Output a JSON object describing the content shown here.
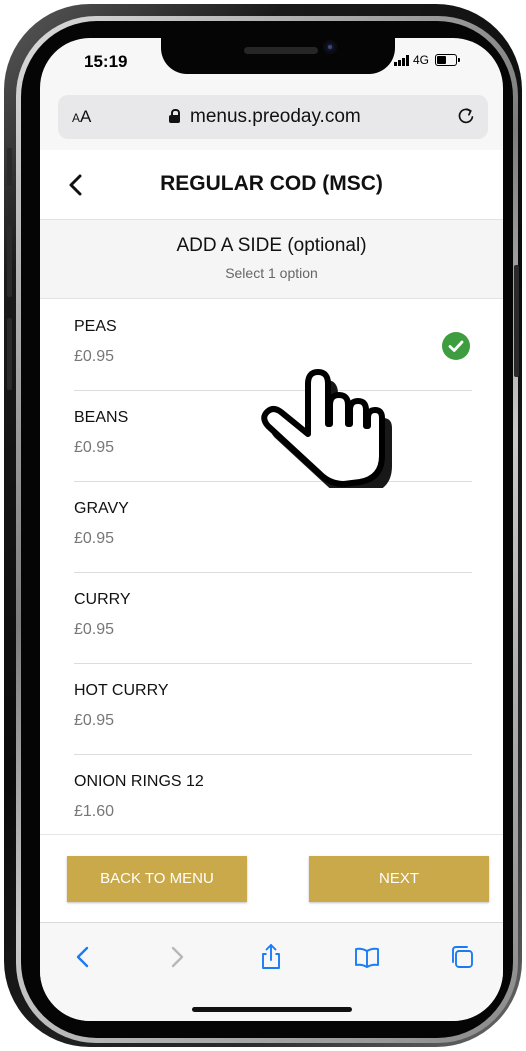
{
  "status": {
    "time": "15:19",
    "network": "4G"
  },
  "browser": {
    "text_size_label": "AA",
    "url": "menus.preoday.com"
  },
  "header": {
    "title": "REGULAR COD (MSC)"
  },
  "section": {
    "title": "ADD A SIDE (optional)",
    "subtitle": "Select 1 option"
  },
  "options": [
    {
      "name": "PEAS",
      "price": "£0.95",
      "selected": true
    },
    {
      "name": "BEANS",
      "price": "£0.95",
      "selected": false
    },
    {
      "name": "GRAVY",
      "price": "£0.95",
      "selected": false
    },
    {
      "name": "CURRY",
      "price": "£0.95",
      "selected": false
    },
    {
      "name": "HOT CURRY",
      "price": "£0.95",
      "selected": false
    },
    {
      "name": "ONION RINGS 12",
      "price": "£1.60",
      "selected": false
    }
  ],
  "actions": {
    "back_label": "BACK TO MENU",
    "next_label": "NEXT"
  },
  "colors": {
    "accent": "#c9a94a",
    "check": "#3e9d3f",
    "ios_blue": "#1a7cf5"
  },
  "icons": {
    "toolbar": [
      "back-icon",
      "forward-icon",
      "share-icon",
      "bookmarks-icon",
      "tabs-icon"
    ]
  }
}
